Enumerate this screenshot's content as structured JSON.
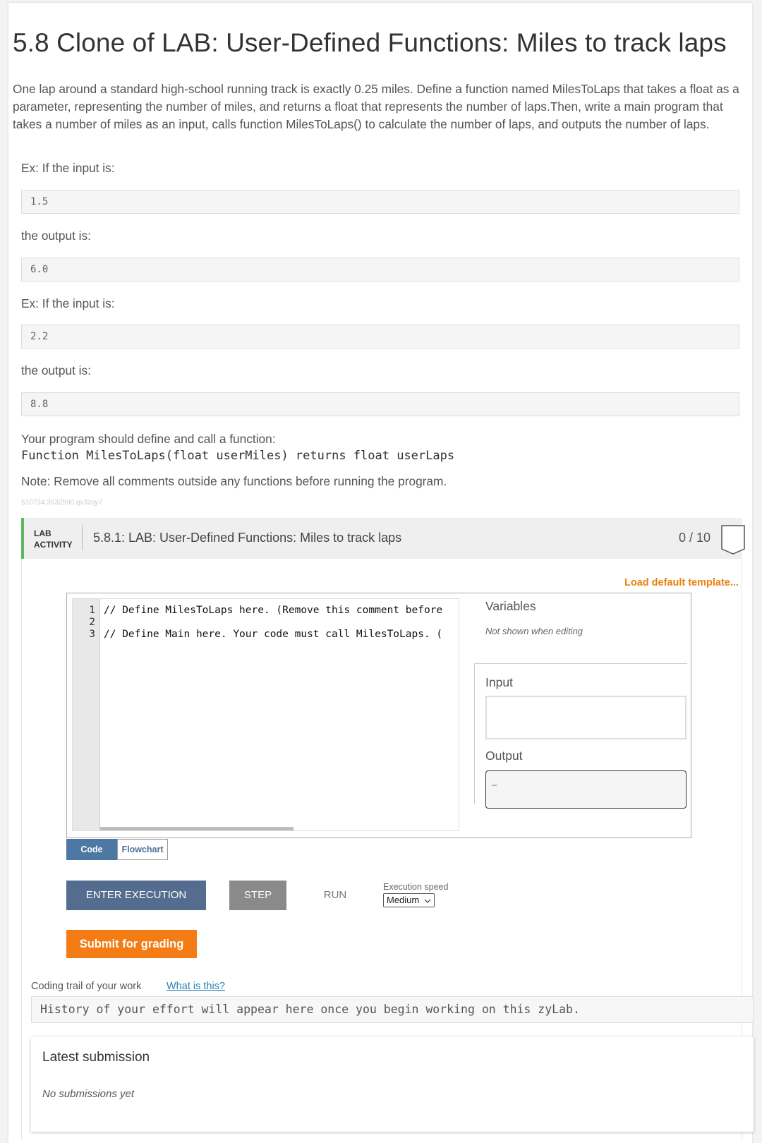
{
  "title": "5.8 Clone of LAB: User-Defined Functions: Miles to track laps",
  "description": "One lap around a standard high-school running track is exactly 0.25 miles. Define a function named MilesToLaps that takes a float as a parameter, representing the number of miles, and returns a float that represents the number of laps.Then, write a main program that takes a number of miles as an input, calls function MilesToLaps() to calculate the number of laps, and outputs the number of laps.",
  "examples": [
    {
      "intro": "Ex: If the input is:",
      "input": "1.5",
      "output_intro": "the output is:",
      "output": "6.0"
    },
    {
      "intro": "Ex: If the input is:",
      "input": "2.2",
      "output_intro": "the output is:",
      "output": "8.8"
    }
  ],
  "instruction": "Your program should define and call a function:",
  "signature": "Function MilesToLaps(float userMiles) returns float userLaps",
  "note": "Note: Remove all comments outside any functions before running the program.",
  "tiny_id": "510734.3532590.qx3zqy7",
  "lab": {
    "tag_line1": "LAB",
    "tag_line2": "ACTIVITY",
    "title": "5.8.1: LAB: User-Defined Functions: Miles to track laps",
    "score": "0 / 10",
    "load_template": "Load default template...",
    "accent_color": "#5cb85c"
  },
  "editor": {
    "lines": [
      {
        "num": "1",
        "text": "// Define MilesToLaps here. (Remove this comment before"
      },
      {
        "num": "2",
        "text": ""
      },
      {
        "num": "3",
        "text": "// Define Main here. Your code must call MilesToLaps. ("
      }
    ]
  },
  "panel": {
    "variables_title": "Variables",
    "variables_note": "Not shown when editing",
    "input_label": "Input",
    "output_label": "Output",
    "output_cursor": "_"
  },
  "tabs": {
    "code": "Code",
    "flowchart": "Flowchart"
  },
  "controls": {
    "enter_execution": "ENTER EXECUTION",
    "step": "STEP",
    "run": "RUN",
    "speed_label": "Execution speed",
    "speed_value": "Medium",
    "submit": "Submit for grading",
    "submit_color": "#f47c14"
  },
  "trail": {
    "label": "Coding trail of your work",
    "link": "What is this?",
    "history": "History of your effort will appear here once you begin working on this zyLab."
  },
  "latest": {
    "title": "Latest submission",
    "note": "No submissions yet"
  }
}
